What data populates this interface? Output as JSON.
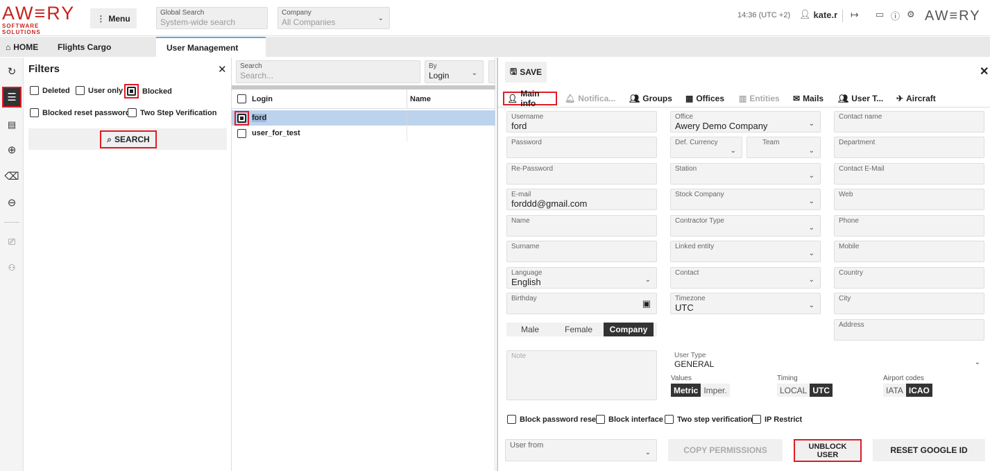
{
  "brand": {
    "logo_main": "AW≡RY",
    "logo_sub": "SOFTWARE SOLUTIONS",
    "right_logo": "AW≡RY",
    "accent": "#c8231f"
  },
  "topbar": {
    "menu_label": "Menu",
    "global_search": {
      "label": "Global Search",
      "placeholder": "System-wide search"
    },
    "company": {
      "label": "Company",
      "value": "All Companies"
    },
    "time": "14:36 (UTC +2)",
    "user": "kate.r"
  },
  "tabs": [
    {
      "label": "HOME"
    },
    {
      "label": "Flights Cargo"
    },
    {
      "label": "User Management"
    }
  ],
  "filters": {
    "title": "Filters",
    "options": [
      {
        "label": "Deleted",
        "checked": false
      },
      {
        "label": "User only",
        "checked": false
      },
      {
        "label": "Blocked",
        "checked": true
      },
      {
        "label": "Blocked reset password",
        "checked": false
      },
      {
        "label": "Two Step Verification",
        "checked": false
      }
    ],
    "search_button": "SEARCH"
  },
  "list": {
    "search": {
      "label": "Search",
      "placeholder": "Search..."
    },
    "by": {
      "label": "By",
      "value": "Login"
    },
    "columns": [
      "Login",
      "Name"
    ],
    "rows": [
      {
        "login": "ford",
        "name": "",
        "selected": true
      },
      {
        "login": "user_for_test",
        "name": "",
        "selected": false
      }
    ]
  },
  "detail": {
    "save_label": "SAVE",
    "tabs": [
      "Main info",
      "Notifica...",
      "Groups",
      "Offices",
      "Entities",
      "Mails",
      "User T...",
      "Aircraft"
    ],
    "col1": [
      {
        "label": "Username",
        "value": "ford"
      },
      {
        "label": "Password",
        "value": ""
      },
      {
        "label": "Re-Password",
        "value": ""
      },
      {
        "label": "E-mail",
        "value": "forddd@gmail.com"
      },
      {
        "label": "Name",
        "value": ""
      },
      {
        "label": "Surname",
        "value": ""
      },
      {
        "label": "Language",
        "value": "English"
      },
      {
        "label": "Birthday",
        "value": ""
      }
    ],
    "col2": [
      {
        "label": "Office",
        "value": "Awery Demo Company"
      },
      {
        "label": "Def. Currency",
        "value": ""
      },
      {
        "label": "Team",
        "value": ""
      },
      {
        "label": "Station",
        "value": ""
      },
      {
        "label": "Stock Company",
        "value": ""
      },
      {
        "label": "Contractor Type",
        "value": ""
      },
      {
        "label": "Linked entity",
        "value": ""
      },
      {
        "label": "Contact",
        "value": ""
      },
      {
        "label": "Timezone",
        "value": "UTC"
      }
    ],
    "col3": [
      {
        "label": "Contact name"
      },
      {
        "label": "Department"
      },
      {
        "label": "Contact E-Mail"
      },
      {
        "label": "Web"
      },
      {
        "label": "Phone"
      },
      {
        "label": "Mobile"
      },
      {
        "label": "Country"
      },
      {
        "label": "City"
      },
      {
        "label": "Address"
      }
    ],
    "gender": [
      "Male",
      "Female",
      "Company"
    ],
    "gender_selected": "Company",
    "note_placeholder": "Note",
    "user_type": {
      "label": "User Type",
      "value": "GENERAL"
    },
    "values": {
      "label": "Values",
      "options": [
        "Metric",
        "Imper."
      ],
      "selected": "Metric"
    },
    "timing": {
      "label": "Timing",
      "options": [
        "LOCAL",
        "UTC"
      ],
      "selected": "UTC"
    },
    "airport_codes": {
      "label": "Airport codes",
      "options": [
        "IATA",
        "ICAO"
      ],
      "selected": "ICAO"
    },
    "checkboxes": [
      "Block password reset",
      "Block interface",
      "Two step verification",
      "IP Restrict"
    ],
    "user_from_label": "User from",
    "copy_permissions": "COPY PERMISSIONS",
    "unblock_user": "UNBLOCK USER",
    "reset_google_id": "RESET GOOGLE ID"
  }
}
